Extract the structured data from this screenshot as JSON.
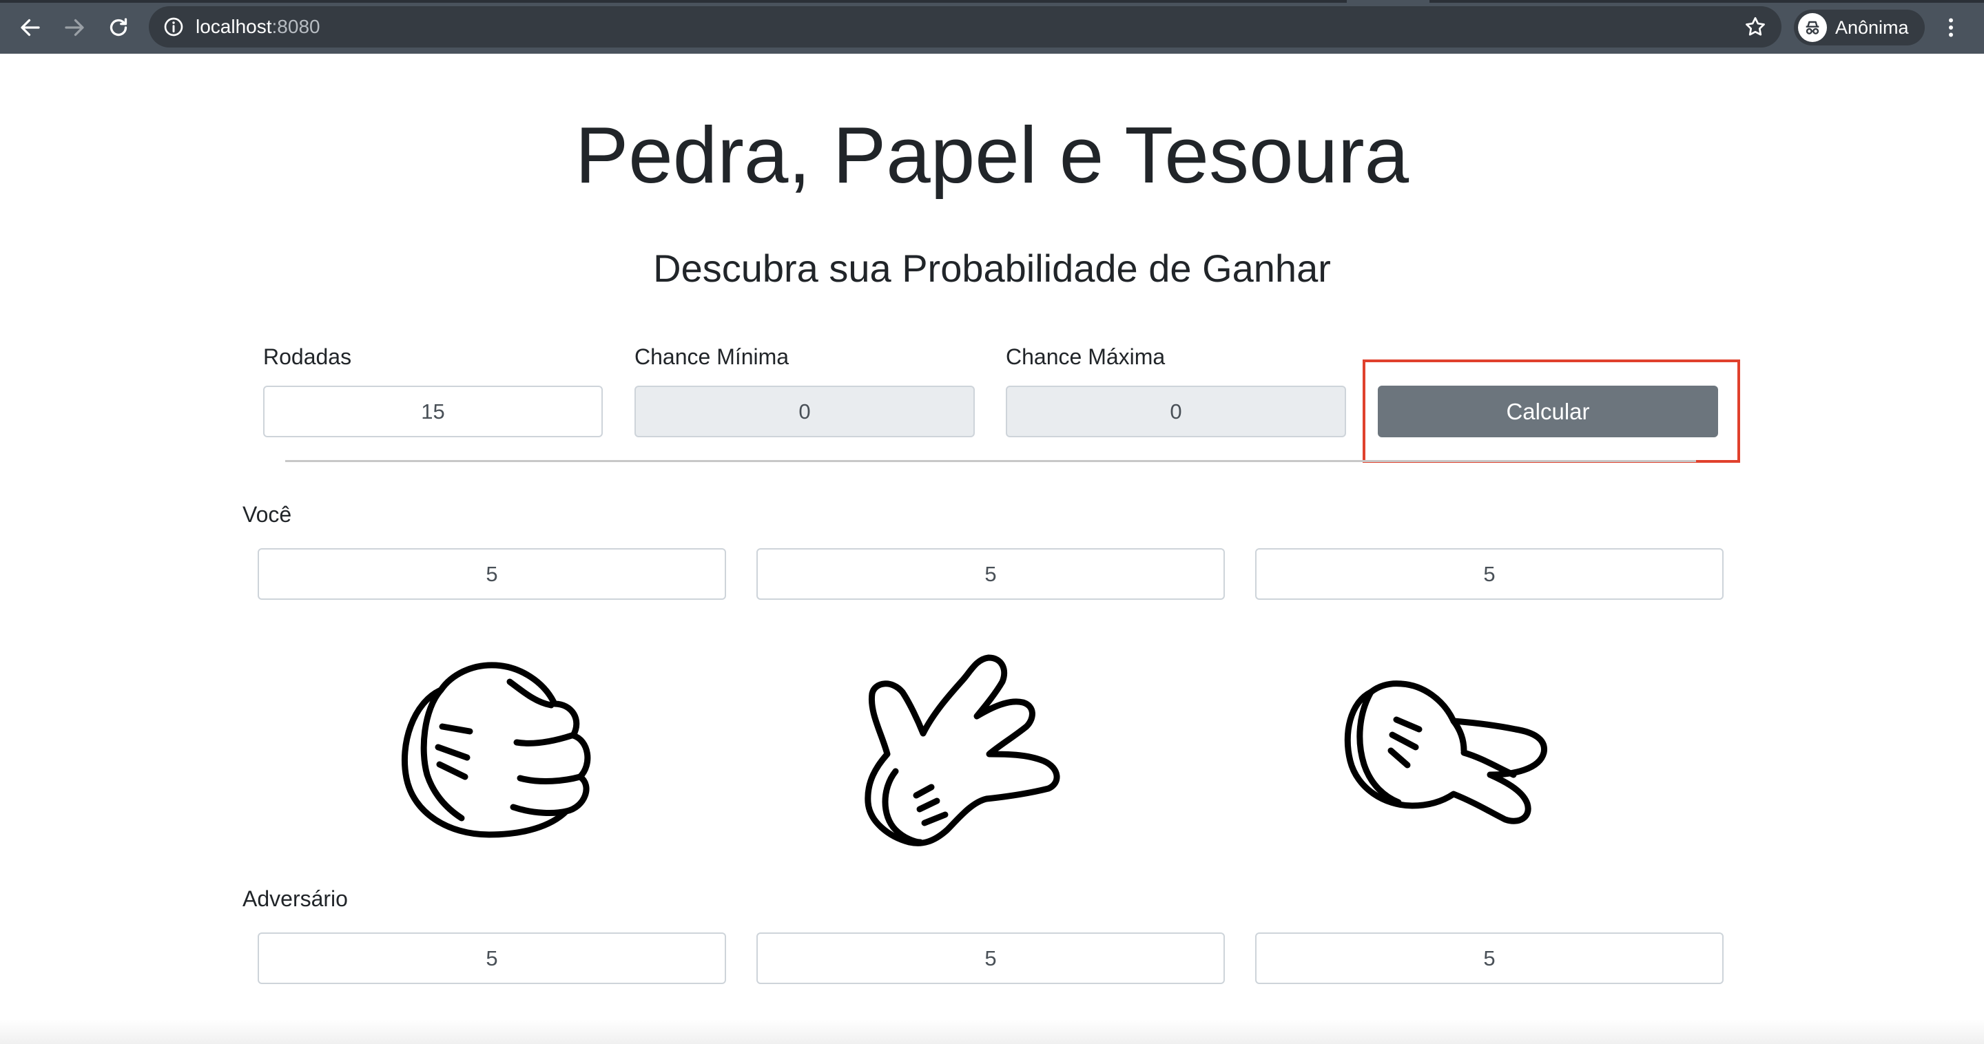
{
  "browser": {
    "url_host": "localhost",
    "url_port": ":8080",
    "profile_label": "Anônima"
  },
  "page": {
    "title": "Pedra, Papel e Tesoura",
    "subtitle": "Descubra sua Probabilidade de Ganhar"
  },
  "controls": {
    "rounds_label": "Rodadas",
    "rounds_value": "15",
    "min_chance_label": "Chance Mínima",
    "min_chance_value": "0",
    "max_chance_label": "Chance Máxima",
    "max_chance_value": "0",
    "calculate_label": "Calcular"
  },
  "you": {
    "label": "Você",
    "values": [
      "5",
      "5",
      "5"
    ]
  },
  "opponent": {
    "label": "Adversário",
    "values": [
      "5",
      "5",
      "5"
    ]
  },
  "icons": [
    "rock-hand-icon",
    "paper-hand-icon",
    "scissors-hand-icon"
  ],
  "colors": {
    "chrome": "#4a535d",
    "button": "#6c757d",
    "highlight": "#e0412d"
  }
}
